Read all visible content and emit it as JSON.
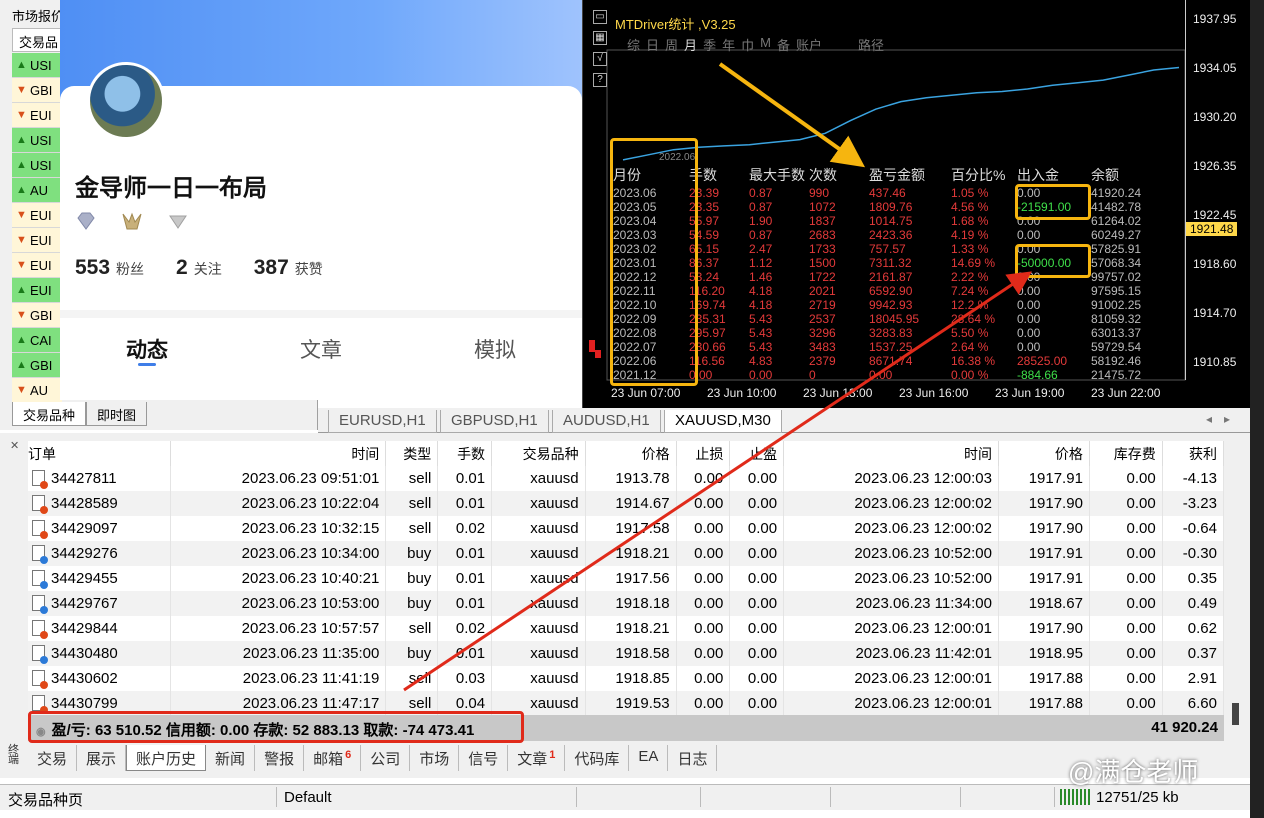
{
  "market_watch": {
    "title": "市场报价",
    "column": "交易品",
    "symbols": [
      {
        "name": "USI",
        "dir": "up"
      },
      {
        "name": "GBI",
        "dir": "dn"
      },
      {
        "name": "EUI",
        "dir": "dn"
      },
      {
        "name": "USI",
        "dir": "up"
      },
      {
        "name": "USI",
        "dir": "up"
      },
      {
        "name": "AU",
        "dir": "up"
      },
      {
        "name": "EUI",
        "dir": "dn"
      },
      {
        "name": "EUI",
        "dir": "dn"
      },
      {
        "name": "EUI",
        "dir": "dn"
      },
      {
        "name": "EUI",
        "dir": "up"
      },
      {
        "name": "GBI",
        "dir": "dn"
      },
      {
        "name": "CAI",
        "dir": "up"
      },
      {
        "name": "GBI",
        "dir": "up"
      },
      {
        "name": "AU",
        "dir": "dn"
      }
    ],
    "tabs": [
      "交易品种",
      "即时图"
    ]
  },
  "profile": {
    "name": "金导师一日一布局",
    "fans": "553",
    "fans_label": "粉丝",
    "follows": "2",
    "follows_label": "关注",
    "likes": "387",
    "likes_label": "获赞",
    "tabs": [
      "动态",
      "文章",
      "模拟"
    ]
  },
  "chart": {
    "indicator_title": "MTDriver统计 ,V3.25",
    "menu": [
      "综",
      "日",
      "周",
      "月",
      "季",
      "年",
      "巾",
      "M",
      "备",
      "账户"
    ],
    "menu_active": "月",
    "menu_path": "路径",
    "mini_year": "2022.06",
    "price_labels": [
      "1937.95",
      "1934.05",
      "1930.20",
      "1926.35",
      "1922.45",
      "1918.60",
      "1914.70",
      "1910.85"
    ],
    "current_price": "1921.48",
    "time_labels": [
      "23 Jun 07:00",
      "23 Jun 10:00",
      "23 Jun 13:00",
      "23 Jun 16:00",
      "23 Jun 19:00",
      "23 Jun 22:00"
    ],
    "stats_headers": [
      "月份",
      "手数",
      "最大手数",
      "次数",
      "盈亏金额",
      "百分比%",
      "出入金",
      "余额"
    ],
    "stats_rows": [
      [
        "2023.06",
        "23.39",
        "0.87",
        "990",
        "437.46",
        "1.05 %",
        "0.00",
        "41920.24"
      ],
      [
        "2023.05",
        "23.35",
        "0.87",
        "1072",
        "1809.76",
        "4.56 %",
        "-21591.00",
        "41482.78"
      ],
      [
        "2023.04",
        "55.97",
        "1.90",
        "1837",
        "1014.75",
        "1.68 %",
        "0.00",
        "61264.02"
      ],
      [
        "2023.03",
        "54.59",
        "0.87",
        "2683",
        "2423.36",
        "4.19 %",
        "0.00",
        "60249.27"
      ],
      [
        "2023.02",
        "65.15",
        "2.47",
        "1733",
        "757.57",
        "1.33 %",
        "0.00",
        "57825.91"
      ],
      [
        "2023.01",
        "86.37",
        "1.12",
        "1500",
        "7311.32",
        "14.69 %",
        "-50000.00",
        "57068.34"
      ],
      [
        "2022.12",
        "53.24",
        "1.46",
        "1722",
        "2161.87",
        "2.22 %",
        "0.00",
        "99757.02"
      ],
      [
        "2022.11",
        "116.20",
        "4.18",
        "2021",
        "6592.90",
        "7.24 %",
        "0.00",
        "97595.15"
      ],
      [
        "2022.10",
        "169.74",
        "4.18",
        "2719",
        "9942.93",
        "12.2 %",
        "0.00",
        "91002.25"
      ],
      [
        "2022.09",
        "235.31",
        "5.43",
        "2537",
        "18045.95",
        "28.64 %",
        "0.00",
        "81059.32"
      ],
      [
        "2022.08",
        "295.97",
        "5.43",
        "3296",
        "3283.83",
        "5.50 %",
        "0.00",
        "63013.37"
      ],
      [
        "2022.07",
        "230.66",
        "5.43",
        "3483",
        "1537.25",
        "2.64 %",
        "0.00",
        "59729.54"
      ],
      [
        "2022.06",
        "116.56",
        "4.83",
        "2379",
        "8671.74",
        "16.38 %",
        "28525.00",
        "58192.46"
      ],
      [
        "2021.12",
        "0.00",
        "0.00",
        "0",
        "0.00",
        "0.00 %",
        "-884.66",
        "21475.72"
      ]
    ],
    "equity_curve": [
      1926.9,
      1927.3,
      1927.7,
      1927.9,
      1928.0,
      1928.1,
      1928.3,
      1928.5,
      1929.0,
      1930.0,
      1930.9,
      1931.5,
      1931.8,
      1932.0,
      1932.2,
      1932.3,
      1932.5,
      1932.8,
      1933.0,
      1933.2,
      1933.6,
      1934.0,
      1934.2
    ],
    "colors": {
      "curve": "#3aa3e0",
      "highlight": "#f6b50f",
      "loss": "#e43a3a",
      "gain": "#3fe04a"
    }
  },
  "chart_tabs": [
    "EURUSD,H1",
    "GBPUSD,H1",
    "AUDUSD,H1",
    "XAUUSD,M30"
  ],
  "chart_tab_active": 3,
  "orders": {
    "headers": [
      "订单",
      "时间",
      "类型",
      "手数",
      "交易品种",
      "价格",
      "止损",
      "止盈",
      "时间",
      "价格",
      "库存费",
      "获利"
    ],
    "rows": [
      [
        "34427811",
        "2023.06.23 09:51:01",
        "sell",
        "0.01",
        "xauusd",
        "1913.78",
        "0.00",
        "0.00",
        "2023.06.23 12:00:03",
        "1917.91",
        "0.00",
        "-4.13"
      ],
      [
        "34428589",
        "2023.06.23 10:22:04",
        "sell",
        "0.01",
        "xauusd",
        "1914.67",
        "0.00",
        "0.00",
        "2023.06.23 12:00:02",
        "1917.90",
        "0.00",
        "-3.23"
      ],
      [
        "34429097",
        "2023.06.23 10:32:15",
        "sell",
        "0.02",
        "xauusd",
        "1917.58",
        "0.00",
        "0.00",
        "2023.06.23 12:00:02",
        "1917.90",
        "0.00",
        "-0.64"
      ],
      [
        "34429276",
        "2023.06.23 10:34:00",
        "buy",
        "0.01",
        "xauusd",
        "1918.21",
        "0.00",
        "0.00",
        "2023.06.23 10:52:00",
        "1917.91",
        "0.00",
        "-0.30"
      ],
      [
        "34429455",
        "2023.06.23 10:40:21",
        "buy",
        "0.01",
        "xauusd",
        "1917.56",
        "0.00",
        "0.00",
        "2023.06.23 10:52:00",
        "1917.91",
        "0.00",
        "0.35"
      ],
      [
        "34429767",
        "2023.06.23 10:53:00",
        "buy",
        "0.01",
        "xauusd",
        "1918.18",
        "0.00",
        "0.00",
        "2023.06.23 11:34:00",
        "1918.67",
        "0.00",
        "0.49"
      ],
      [
        "34429844",
        "2023.06.23 10:57:57",
        "sell",
        "0.02",
        "xauusd",
        "1918.21",
        "0.00",
        "0.00",
        "2023.06.23 12:00:01",
        "1917.90",
        "0.00",
        "0.62"
      ],
      [
        "34430480",
        "2023.06.23 11:35:00",
        "buy",
        "0.01",
        "xauusd",
        "1918.58",
        "0.00",
        "0.00",
        "2023.06.23 11:42:01",
        "1918.95",
        "0.00",
        "0.37"
      ],
      [
        "34430602",
        "2023.06.23 11:41:19",
        "sell",
        "0.03",
        "xauusd",
        "1918.85",
        "0.00",
        "0.00",
        "2023.06.23 12:00:01",
        "1917.88",
        "0.00",
        "2.91"
      ],
      [
        "34430799",
        "2023.06.23 11:47:17",
        "sell",
        "0.04",
        "xauusd",
        "1919.53",
        "0.00",
        "0.00",
        "2023.06.23 12:00:01",
        "1917.88",
        "0.00",
        "6.60"
      ]
    ],
    "summary": "盈/亏: 63 510.52  信用额: 0.00  存款: 52 883.13  取款: -74 473.41",
    "summary_total": "41 920.24"
  },
  "bottom_tabs": [
    {
      "label": "交易"
    },
    {
      "label": "展示"
    },
    {
      "label": "账户历史",
      "active": true
    },
    {
      "label": "新闻"
    },
    {
      "label": "警报"
    },
    {
      "label": "邮箱",
      "badge": "6"
    },
    {
      "label": "公司"
    },
    {
      "label": "市场"
    },
    {
      "label": "信号"
    },
    {
      "label": "文章",
      "badge": "1"
    },
    {
      "label": "代码库"
    },
    {
      "label": "EA"
    },
    {
      "label": "日志"
    }
  ],
  "terminal_side_label": "终端",
  "status": {
    "left": "交易品种页",
    "profile": "Default",
    "traffic": "12751/25 kb"
  },
  "watermark": "@满仓老师"
}
